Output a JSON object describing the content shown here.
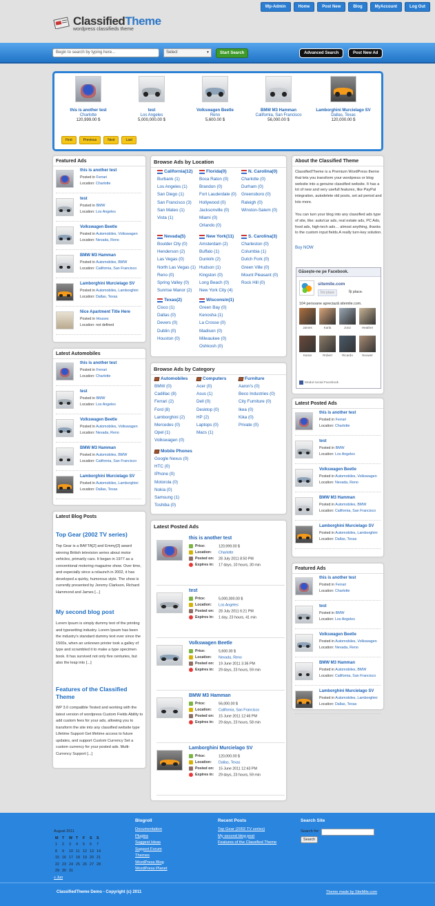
{
  "topnav": [
    "Wp-Admin",
    "Home",
    "Post New",
    "Blog",
    "MyAccount",
    "Log Out"
  ],
  "logo": {
    "part1": "Classified",
    "part2": "Theme",
    "tagline": "wordpress classifieds theme"
  },
  "search": {
    "placeholder": "Begin to search by typing here...",
    "select": "Select",
    "submit": "Start Search",
    "advanced": "Advanced Search",
    "post_ad": "Post New Ad"
  },
  "slider": {
    "items": [
      {
        "title": "this is another test",
        "location": "Charlotte",
        "price": "120,999.00 $"
      },
      {
        "title": "test",
        "location": "Los Angeles",
        "price": "5,000,000.00 $"
      },
      {
        "title": "Volkswagen Beetle",
        "location": "Reno",
        "price": "5,600.00 $"
      },
      {
        "title": "BMW M3 Hamman",
        "location": "California, San Francisco",
        "price": "56,000.00 $"
      },
      {
        "title": "Lamborghini Murcielago SV",
        "location": "Dallas, Texas",
        "price": "120,000.00 $"
      }
    ],
    "pager": [
      "First",
      "Previous",
      "Next",
      "Last"
    ]
  },
  "featured": {
    "title": "Featured Ads",
    "posted_in": "Posted in",
    "location": "Location:",
    "items": [
      {
        "title": "this is another test",
        "cat": "Ferrari",
        "loc": "Charlotte"
      },
      {
        "title": "test",
        "cat": "BMW",
        "loc": "Los Angeles"
      },
      {
        "title": "Volkswagen Beetle",
        "cat": "Automobiles, Volkswagen",
        "loc": "Nevada, Reno"
      },
      {
        "title": "BMW M3 Hamman",
        "cat": "Automobiles, BMW",
        "loc": "California, San Francisco"
      },
      {
        "title": "Lamborghini Murcielago SV",
        "cat": "Automobiles, Lamborghini",
        "loc": "Dallas, Texas"
      },
      {
        "title": "Nice Apartment Title Here",
        "cat": "Houses",
        "loc": "not defined"
      }
    ]
  },
  "latest_auto": {
    "title": "Latest Automobiles",
    "items": [
      {
        "title": "this is another test",
        "cat": "Ferrari",
        "loc": "Charlotte"
      },
      {
        "title": "test",
        "cat": "BMW",
        "loc": "Los Angeles"
      },
      {
        "title": "Volkswagen Beetle",
        "cat": "Automobiles, Volkswagen",
        "loc": "Nevada, Reno"
      },
      {
        "title": "BMW M3 Hamman",
        "cat": "Automobiles, BMW",
        "loc": "California, San Francisco"
      },
      {
        "title": "Lamborghini Murcielago SV",
        "cat": "Automobiles, Lamborghini",
        "loc": "Dallas, Texas"
      }
    ]
  },
  "blog": {
    "title": "Latest Blog Posts",
    "posts": [
      {
        "title": "Top Gear (2002 TV series)",
        "body": "Top Gear is a BAFTA[2] and Emmy[3] award winning British television series about motor vehicles, primarily cars. It began in 1977 as a conventional motoring magazine show. Over time, and especially since a relaunch in 2002, it has developed a quirky, humorous style. The show is currently presented by Jeremy Clarkson, Richard Hammond and James [...]"
      },
      {
        "title": "My second blog post",
        "body": "Lorem Ipsum is simply dummy text of the printing and typesetting industry. Lorem Ipsum has been the industry's standard dummy text ever since the 1500s, when an unknown printer took a galley of type and scrambled it to make a type specimen book. It has survived not only five centuries, but also the leap into [...]"
      },
      {
        "title": "Features of the Classified Theme",
        "body": "WP 3.0 compatible Tested and working with the latest version of wordpress Custom Fields Ability to add custom fees for your ads, allowing you to transform the site into any classified website type Lifetime Support Get lifetime access to future updates, and support Custom Currency Set a custom currency for your posted ads. Multi-Currency Support [...]"
      }
    ]
  },
  "browse_loc": {
    "title": "Browse Ads by Location",
    "groups": [
      {
        "head": "California(12)",
        "items": [
          "Burbank (1)",
          "Los Angeles (1)",
          "San Diego (1)",
          "San Francisco (3)",
          "San Mateo (1)",
          "Vista (1)"
        ]
      },
      {
        "head": "Florida(0)",
        "items": [
          "Boca Raton (0)",
          "Brandon (0)",
          "Fort Lauderdale (0)",
          "Hollywood (0)",
          "Jacksonville (0)",
          "Miami (0)",
          "Orlando (0)"
        ]
      },
      {
        "head": "N. Carolina(0)",
        "items": [
          "Charlotte (0)",
          "Durham (0)",
          "Greensboro (0)",
          "Raleigh (0)",
          "Winston-Salem (0)"
        ]
      },
      {
        "head": "Nevada(5)",
        "items": [
          "Boulder City (0)",
          "Henderson (2)",
          "Las Vegas (0)",
          "North Las Vegas (1)",
          "Reno (0)",
          "Spring Valley (0)",
          "Sunrise Manor (2)"
        ]
      },
      {
        "head": "New York(11)",
        "items": [
          "Amsterdam (2)",
          "Buffalo (1)",
          "Dunkirk (2)",
          "Hudson (1)",
          "Kingston (0)",
          "Long Beach (0)",
          "New York City (4)"
        ]
      },
      {
        "head": "S. Carolina(3)",
        "items": [
          "Charleston (0)",
          "Columbia (1)",
          "Dutch Fork (0)",
          "Green Ville (0)",
          "Mount Pleasant (0)",
          "Rock Hill (0)"
        ]
      },
      {
        "head": "Texas(2)",
        "items": [
          "Cisco (1)",
          "Dallas (0)",
          "Devers (0)",
          "Dublin (0)",
          "Houston (0)"
        ]
      },
      {
        "head": "Wisconsin(1)",
        "items": [
          "Green Bay (0)",
          "Kenosha (1)",
          "La Crosse (0)",
          "Madison (0)",
          "Milwaukee (0)",
          "Oshkosh (0)"
        ]
      }
    ]
  },
  "browse_cat": {
    "title": "Browse Ads by Category",
    "groups": [
      {
        "head": "Automobiles",
        "items": [
          "BMW (0)",
          "Cadillac (8)",
          "Ferrari (2)",
          "Ford (8)",
          "Lamborghini (2)",
          "Mercedes (0)",
          "Opel (1)",
          "Volkswagen (0)"
        ]
      },
      {
        "head": "Computers",
        "items": [
          "Acer (0)",
          "Asus (1)",
          "Dell (0)",
          "Desktop (0)",
          "HP (2)",
          "Laptops (0)",
          "Macs (1)"
        ]
      },
      {
        "head": "Furniture",
        "items": [
          "Aaron's (0)",
          "Beco Industries (0)",
          "City Furniture (0)",
          "Ikea (0)",
          "Kika (0)",
          "Private (0)"
        ]
      },
      {
        "head": "Mobile Phones",
        "items": [
          "Google Nexus (0)",
          "HTC (0)",
          "IPhone (0)",
          "Motorola (0)",
          "Nokia (0)",
          "Samsung (1)",
          "Toshiba (0)"
        ]
      }
    ]
  },
  "latest_posted": {
    "title": "Latest Posted Ads",
    "labels": {
      "price": "Price:",
      "location": "Location:",
      "posted": "Posted on:",
      "expires": "Expires in:"
    },
    "items": [
      {
        "title": "this is another test",
        "price": "120,999.00 $",
        "location": "Charlotte",
        "posted": "28 July 2011 8:50 PM",
        "expires": "17 days, 10 hours, 30 min"
      },
      {
        "title": "test",
        "price": "5,000,000.00 $",
        "location": "Los Angeles",
        "posted": "28 July 2011 6:21 PM",
        "expires": "1 day, 23 hours, 41 min"
      },
      {
        "title": "Volkswagen Beetle",
        "price": "5,600.00 $",
        "location": "Nevada, Reno",
        "posted": "19 June 2011 3:36 PM",
        "expires": "29 days, 23 hours, 59 min"
      },
      {
        "title": "BMW M3 Hamman",
        "price": "56,000.00 $",
        "location": "California, San Francisco",
        "posted": "15 June 2011 12:46 PM",
        "expires": "29 days, 23 hours, 58 min"
      },
      {
        "title": "Lamborghini Murcielago SV",
        "price": "120,000.00 $",
        "location": "Dallas, Texas",
        "posted": "15 June 2011 12:43 PM",
        "expires": "29 days, 23 hours, 59 min"
      }
    ]
  },
  "about": {
    "title": "About the Classified Theme",
    "p1": "ClassifiedTheme is a Premium WordPress theme that lets you transform your wordpress or blog website into a genuine classified website. It has a lot of new and very usefull features, like PayPal integration, autodelete old posts, set ad period and lots more.",
    "p2": "You can turn your blog into any classified ads type of site, like: auto/car ads, real estate ads, PC Ads, food ads, high-tech ads… almost anything, thanks to the custom input fields.A really turn-key solution.",
    "buy": "Buy NOW"
  },
  "facebook": {
    "title": "Găsește-ne pe Facebook.",
    "site": "sitemile.com",
    "like_btn": "Îmi place",
    "like_text": "Îți place.",
    "count_text": "104 persoane apreciază sitemile.com.",
    "names": [
      "James",
      "Karla",
      "Jon2",
      "Heather",
      "Karan",
      "Robert",
      "Ricardo",
      "Nouwer"
    ],
    "plugin": "Modul social Facebook"
  },
  "right_latest": {
    "title": "Latest Posted Ads",
    "items": [
      {
        "title": "this is another test",
        "cat": "Ferrari",
        "loc": "Charlotte"
      },
      {
        "title": "test",
        "cat": "BMW",
        "loc": "Los Angeles"
      },
      {
        "title": "Volkswagen Beetle",
        "cat": "Automobiles, Volkswagen",
        "loc": "Nevada, Reno"
      },
      {
        "title": "BMW M3 Hamman",
        "cat": "Automobiles, BMW",
        "loc": "California, San Francisco"
      },
      {
        "title": "Lamborghini Murcielago SV",
        "cat": "Automobiles, Lamborghini",
        "loc": "Dallas, Texas"
      }
    ]
  },
  "right_featured": {
    "title": "Featured Ads",
    "items": [
      {
        "title": "this is another test",
        "cat": "Ferrari",
        "loc": "Charlotte"
      },
      {
        "title": "test",
        "cat": "BMW",
        "loc": "Los Angeles"
      },
      {
        "title": "Volkswagen Beetle",
        "cat": "Automobiles, Volkswagen",
        "loc": "Nevada, Reno"
      },
      {
        "title": "BMW M3 Hamman",
        "cat": "Automobiles, BMW",
        "loc": "California, San Francisco"
      },
      {
        "title": "Lamborghini Murcielago SV",
        "cat": "Automobiles, Lamborghini",
        "loc": "Dallas, Texas"
      }
    ]
  },
  "footer": {
    "calendar": {
      "caption": "August 2011",
      "days": [
        "M",
        "T",
        "W",
        "T",
        "F",
        "S",
        "S"
      ],
      "rows": [
        [
          "1",
          "2",
          "3",
          "4",
          "5",
          "6",
          "7"
        ],
        [
          "8",
          "9",
          "10",
          "11",
          "12",
          "13",
          "14"
        ],
        [
          "15",
          "16",
          "17",
          "18",
          "19",
          "20",
          "21"
        ],
        [
          "22",
          "23",
          "24",
          "25",
          "26",
          "27",
          "28"
        ],
        [
          "29",
          "30",
          "31",
          "",
          "",
          "",
          ""
        ]
      ],
      "prev": "« Jun"
    },
    "blogroll": {
      "title": "Blogroll",
      "links": [
        "Documentation",
        "Plugins",
        "Suggest Ideas",
        "Support Forum",
        "Themes",
        "WordPress Blog",
        "WordPress Planet"
      ]
    },
    "recent": {
      "title": "Recent Posts",
      "links": [
        "Top Gear (2002 TV series)",
        "My second blog post",
        "Features of the Classified Theme"
      ]
    },
    "search": {
      "title": "Search Site",
      "label": "Search for:",
      "button": "Search"
    },
    "copyright": "ClassifiedTheme Demo - Copyright (c) 2011",
    "credit": "Theme made by SiteMile.com"
  },
  "colors": {
    "accent": "#2a85df",
    "link": "#1a5fb4",
    "search_btn": "#3e9a2a",
    "pager": "#f5c518"
  }
}
